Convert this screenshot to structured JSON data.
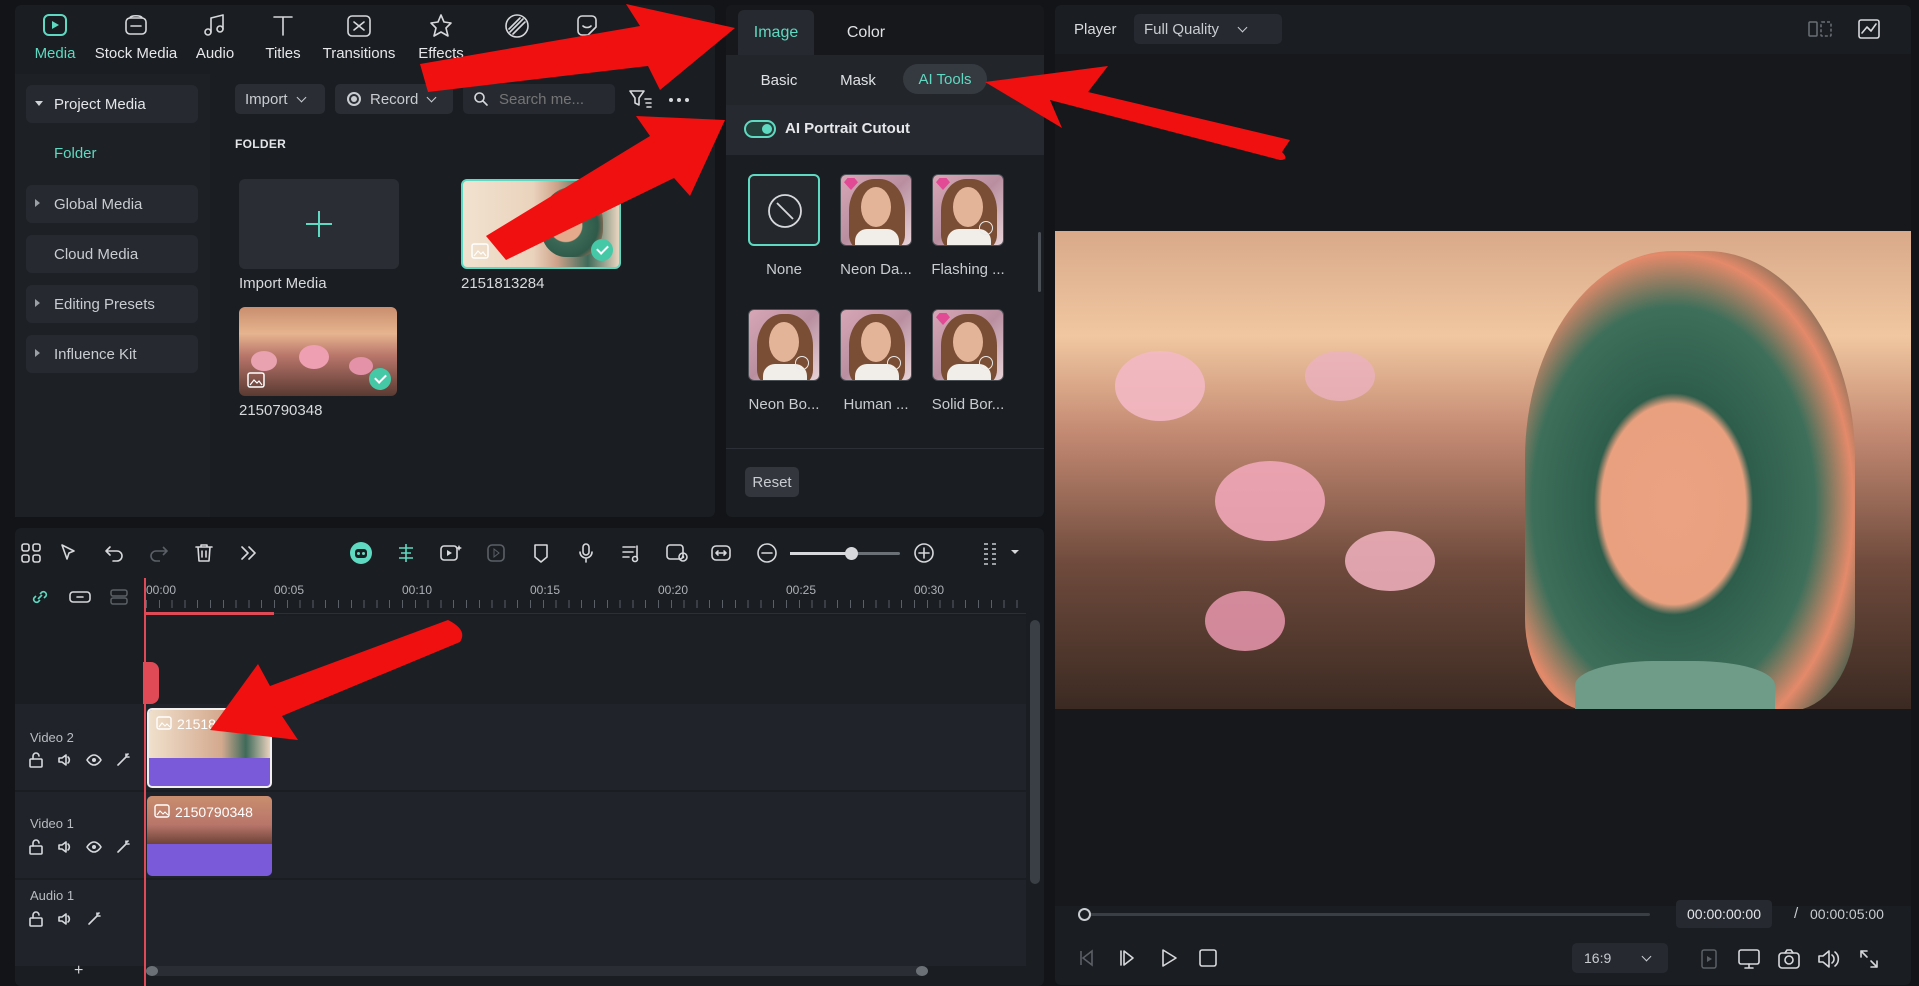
{
  "nav": {
    "items": [
      {
        "label": "Media",
        "icon": "media-icon",
        "active": true
      },
      {
        "label": "Stock Media",
        "icon": "stock-media-icon"
      },
      {
        "label": "Audio",
        "icon": "audio-icon"
      },
      {
        "label": "Titles",
        "icon": "titles-icon"
      },
      {
        "label": "Transitions",
        "icon": "transitions-icon"
      },
      {
        "label": "Effects",
        "icon": "effects-icon"
      }
    ]
  },
  "sidebar": {
    "items": [
      {
        "label": "Project Media"
      },
      {
        "label": "Folder"
      },
      {
        "label": "Global Media"
      },
      {
        "label": "Cloud Media"
      },
      {
        "label": "Editing Presets"
      },
      {
        "label": "Influence Kit"
      }
    ]
  },
  "media": {
    "import_label": "Import",
    "record_label": "Record",
    "search_placeholder": "Search me...",
    "folder_heading": "FOLDER",
    "import_media_label": "Import Media",
    "items": [
      {
        "name": "2151813284"
      },
      {
        "name": "2150790348"
      }
    ]
  },
  "properties": {
    "tabs": [
      "Image",
      "Color"
    ],
    "subtabs": [
      "Basic",
      "Mask",
      "AI Tools"
    ],
    "toggle_label": "AI Portrait Cutout",
    "toggle_on": true,
    "cutouts": [
      {
        "label": "None"
      },
      {
        "label": "Neon Da..."
      },
      {
        "label": "Flashing ..."
      },
      {
        "label": "Neon Bo..."
      },
      {
        "label": "Human ..."
      },
      {
        "label": "Solid Bor..."
      }
    ],
    "reset_label": "Reset"
  },
  "timeline": {
    "ticks": [
      "00:00",
      "00:05",
      "00:10",
      "00:15",
      "00:20",
      "00:25",
      "00:30"
    ],
    "tracks": [
      {
        "name": "Video 2",
        "clip": "2151813284"
      },
      {
        "name": "Video 1",
        "clip": "2150790348"
      },
      {
        "name": "Audio 1"
      }
    ],
    "add_label": "+"
  },
  "player": {
    "label": "Player",
    "quality": "Full Quality",
    "current_time": "00:00:00:00",
    "separator": "/",
    "total_time": "00:00:05:00",
    "aspect": "16:9"
  },
  "colors": {
    "accent": "#5fd9c1",
    "annotation_arrow": "#f01010",
    "clip_purple": "#7a5ad8"
  }
}
